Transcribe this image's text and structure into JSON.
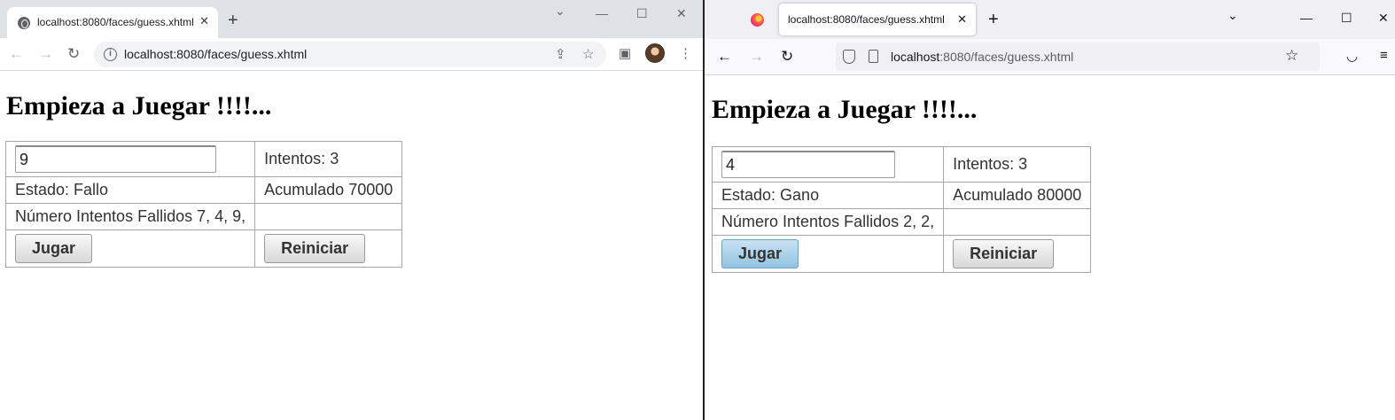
{
  "chrome": {
    "tab_title": "localhost:8080/faces/guess.xhtml",
    "url": "localhost:8080/faces/guess.xhtml",
    "page": {
      "title": "Empieza a Juegar !!!!...",
      "input_value": "9",
      "intentos": "Intentos: 3",
      "estado": "Estado: Fallo",
      "acumulado": "Acumulado 70000",
      "fallidos": "Número Intentos Fallidos 7, 4, 9,",
      "jugar_label": "Jugar",
      "reiniciar_label": "Reiniciar"
    }
  },
  "firefox": {
    "tab_title": "localhost:8080/faces/guess.xhtml",
    "url_host": "localhost",
    "url_rest": ":8080/faces/guess.xhtml",
    "page": {
      "title": "Empieza a Juegar !!!!...",
      "input_value": "4",
      "intentos": "Intentos: 3",
      "estado": "Estado: Gano",
      "acumulado": "Acumulado 80000",
      "fallidos": "Número Intentos Fallidos 2, 2,",
      "jugar_label": "Jugar",
      "reiniciar_label": "Reiniciar"
    }
  },
  "icons": {
    "close": "✕",
    "new_tab": "+",
    "chevron": "⌄",
    "minimize": "—",
    "maximize": "☐",
    "back": "←",
    "forward": "→",
    "reload": "↻",
    "star": "☆",
    "share": "⇪",
    "sidepanel": "▣",
    "menu": "⋮",
    "pocket": "◡",
    "hamburger": "≡",
    "info": "i"
  }
}
